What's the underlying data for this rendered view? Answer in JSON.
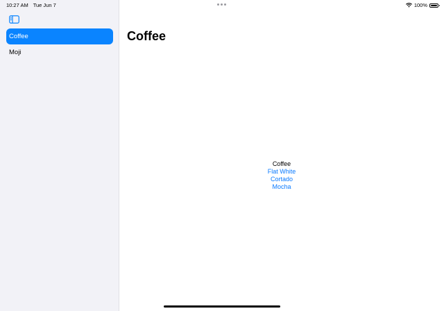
{
  "status_bar": {
    "time": "10:27 AM",
    "date": "Tue Jun 7",
    "battery": "100%",
    "wifi_icon": "wifi-icon",
    "battery_icon": "battery-icon"
  },
  "sidebar": {
    "toggle_icon": "sidebar-toggle-icon",
    "items": [
      {
        "label": "Coffee",
        "selected": true
      },
      {
        "label": "Moji",
        "selected": false
      }
    ]
  },
  "detail": {
    "title": "Coffee",
    "heading": "Coffee",
    "links": [
      "Flat White",
      "Cortado",
      "Mocha"
    ]
  },
  "colors": {
    "accent": "#0a84ff",
    "sidebar_bg": "#f2f2f7",
    "link": "#0a7aff"
  }
}
